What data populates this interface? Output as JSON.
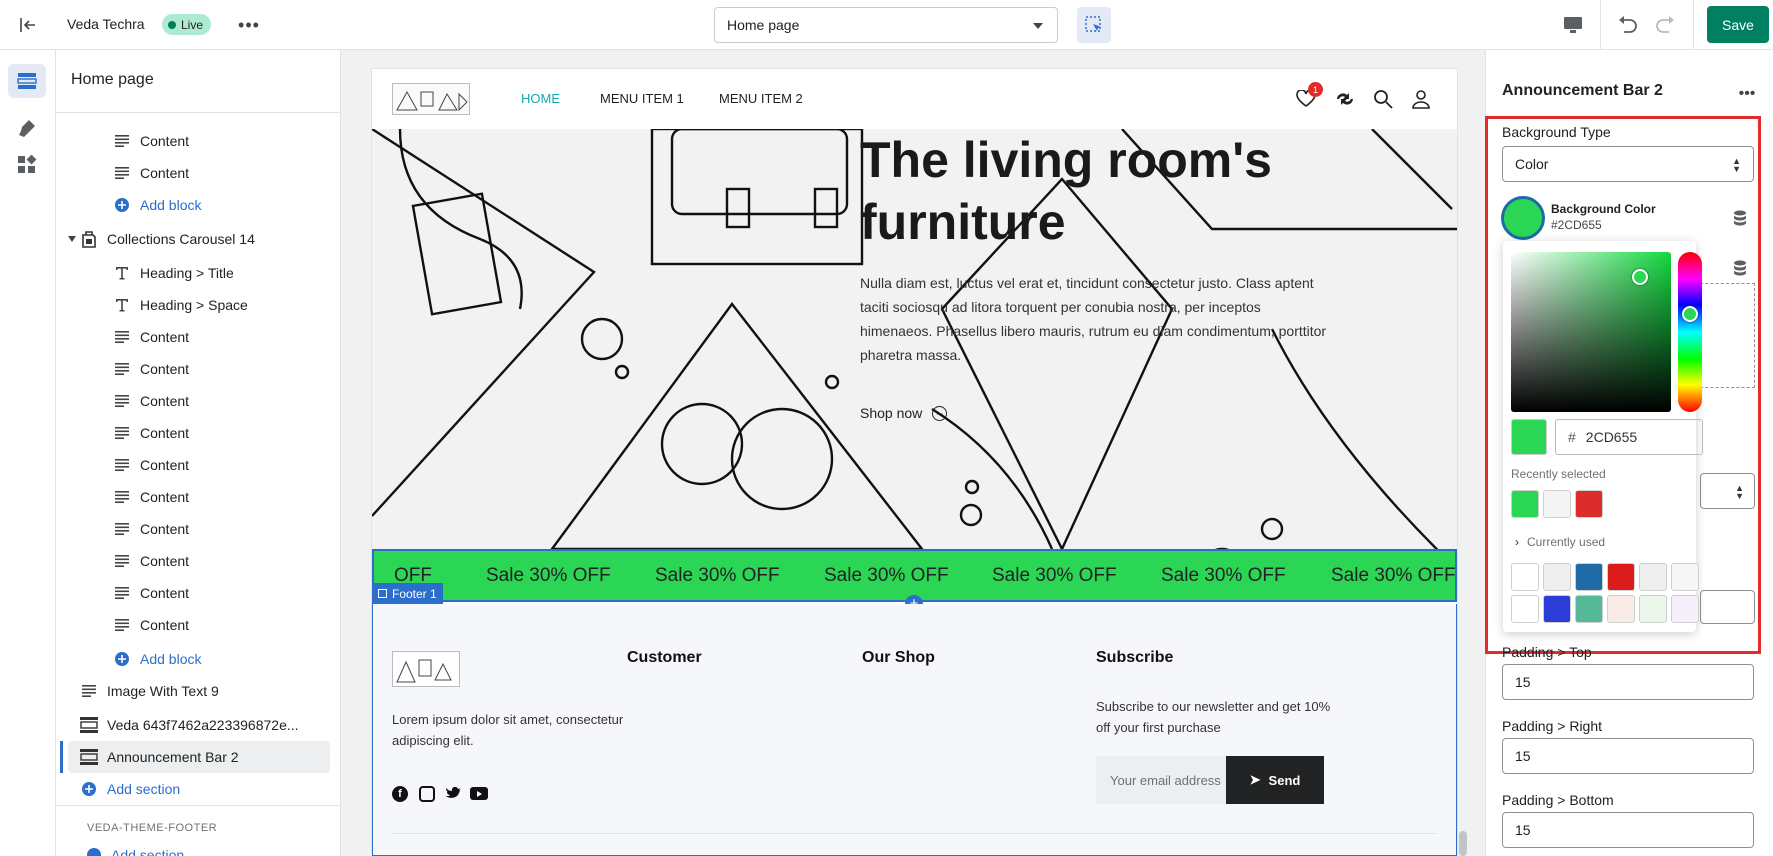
{
  "topbar": {
    "store_name": "Veda Techra",
    "status_badge": "Live",
    "page_select": "Home page",
    "save_label": "Save"
  },
  "left_panel": {
    "title": "Home page",
    "rows": [
      {
        "label": "Content",
        "icon": "lines-icon"
      },
      {
        "label": "Content",
        "icon": "lines-icon"
      },
      {
        "label": "Add block",
        "icon": "plus-circle-icon"
      },
      {
        "label": "Collections Carousel 14",
        "icon": "collection-icon"
      },
      {
        "label": "Heading > Title",
        "icon": "text-icon"
      },
      {
        "label": "Heading > Space",
        "icon": "text-icon"
      },
      {
        "label": "Content",
        "icon": "lines-icon"
      },
      {
        "label": "Content",
        "icon": "lines-icon"
      },
      {
        "label": "Content",
        "icon": "lines-icon"
      },
      {
        "label": "Content",
        "icon": "lines-icon"
      },
      {
        "label": "Content",
        "icon": "lines-icon"
      },
      {
        "label": "Content",
        "icon": "lines-icon"
      },
      {
        "label": "Content",
        "icon": "lines-icon"
      },
      {
        "label": "Content",
        "icon": "lines-icon"
      },
      {
        "label": "Content",
        "icon": "lines-icon"
      },
      {
        "label": "Content",
        "icon": "lines-icon"
      },
      {
        "label": "Add block",
        "icon": "plus-circle-icon"
      },
      {
        "label": "Image With Text 9",
        "icon": "lines-icon"
      },
      {
        "label": "Veda 643f7462a223396872e...",
        "icon": "section-icon"
      },
      {
        "label": "Announcement Bar 2",
        "icon": "section-icon"
      },
      {
        "label": "Add section",
        "icon": "plus-circle-icon"
      }
    ],
    "footer_group": "VEDA-THEME-FOOTER",
    "footer_add": "Add section"
  },
  "preview": {
    "nav": [
      "HOME",
      "MENU ITEM 1",
      "MENU ITEM 2"
    ],
    "wishlist_count": "1",
    "hero_title_1": "The living room's",
    "hero_title_2": "furniture",
    "hero_text_1": "Nulla diam est, luctus vel erat et, tincidunt consectetur justo. Class aptent",
    "hero_text_2": "taciti sociosqu ad litora torquent per conubia nostra, per inceptos",
    "hero_text_3": "himenaeos. Phasellus libero mauris, rutrum eu diam condimentum, porttitor",
    "hero_text_4": "pharetra massa.",
    "shop_now": "Shop now",
    "sale_items": [
      "OFF",
      "Sale 30% OFF",
      "Sale 30% OFF",
      "Sale 30% OFF",
      "Sale 30% OFF",
      "Sale 30% OFF",
      "Sale 30% OFF"
    ],
    "footer_tag": "Footer 1",
    "footer_lorem_1": "Lorem ipsum dolor sit amet, consectetur",
    "footer_lorem_2": "adipiscing elit.",
    "col_customer": "Customer",
    "col_shop": "Our Shop",
    "col_subscribe": "Subscribe",
    "subscribe_text_1": "Subscribe to our newsletter and get 10%",
    "subscribe_text_2": "off your first purchase",
    "email_placeholder": "Your email address",
    "send_label": "Send"
  },
  "right_panel": {
    "title": "Announcement Bar 2",
    "bg_type_label": "Background Type",
    "bg_type_value": "Color",
    "bg_color_label": "Background Color",
    "bg_color_value": "#2CD655",
    "hex_prefix": "#",
    "hex_value": "2CD655",
    "recently_selected": "Recently selected",
    "currently_used": "Currently used",
    "padding_top_label": "Padding > Top",
    "padding_top": "15",
    "padding_right_label": "Padding > Right",
    "padding_right": "15",
    "padding_bottom_label": "Padding > Bottom",
    "padding_bottom": "15"
  },
  "colors": {
    "accent_green": "#2CD655",
    "save_green": "#008060",
    "link_blue": "#2c6ecb",
    "highlight_red": "#e22b2b",
    "recent_swatches": [
      "#2CD655",
      "#f4f4f4",
      "#db2c2c"
    ],
    "used_swatches": [
      "#ffffff",
      "#efefef",
      "#1d6aa7",
      "#db1c1c",
      "#efefef",
      "#f6f6f6",
      "#ffffff",
      "#2c3cd6",
      "#55b898",
      "#f9ebe7",
      "#eaf7ea",
      "#f6f0fb"
    ]
  }
}
